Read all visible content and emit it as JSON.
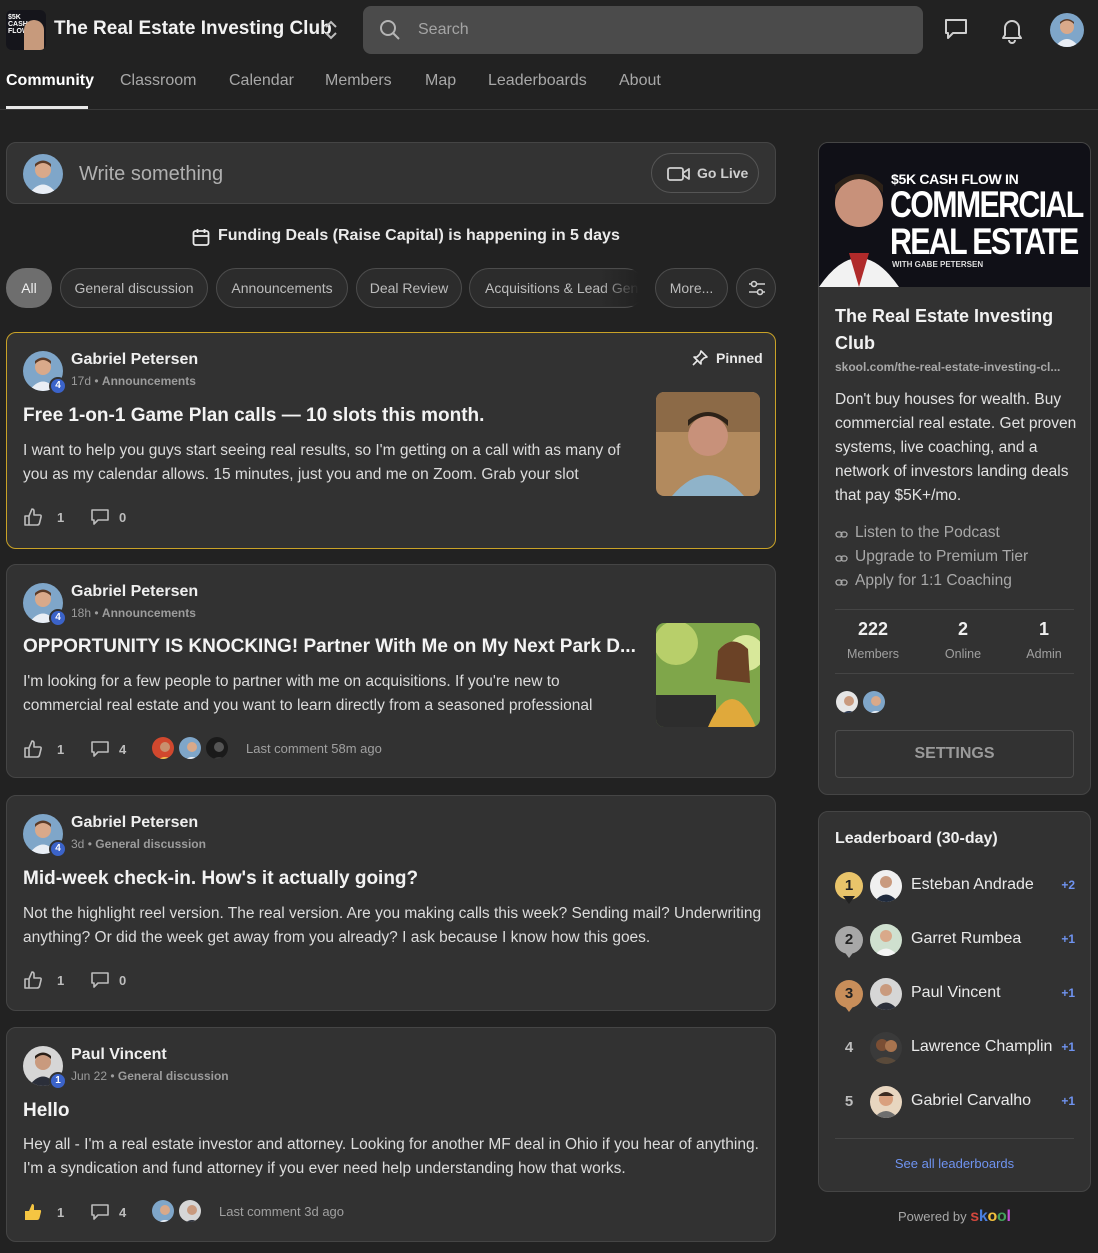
{
  "header": {
    "club_title": "The Real Estate Investing Club",
    "logo_text": "$5K CASH FLOW",
    "search_placeholder": "Search",
    "icons": [
      "chevron-updown-icon",
      "search-icon",
      "chat-icon",
      "bell-icon"
    ]
  },
  "nav": {
    "tabs": [
      {
        "label": "Community",
        "active": true
      },
      {
        "label": "Classroom"
      },
      {
        "label": "Calendar"
      },
      {
        "label": "Members"
      },
      {
        "label": "Map"
      },
      {
        "label": "Leaderboards"
      },
      {
        "label": "About"
      }
    ]
  },
  "composer": {
    "placeholder": "Write something",
    "go_live": "Go Live"
  },
  "event_banner": {
    "text": "Funding Deals (Raise Capital) is happening in 5 days"
  },
  "filters": {
    "chips": [
      "All",
      "General discussion",
      "Announcements",
      "Deal Review",
      "Acquisitions & Lead Gen",
      "More..."
    ]
  },
  "posts": [
    {
      "author": "Gabriel Petersen",
      "level": "4",
      "time": "17d",
      "category": "Announcements",
      "pinned_label": "Pinned",
      "title": "Free 1-on-1 Game Plan calls — 10 slots this month.",
      "body": "I want to help you guys start seeing real results, so I'm getting on a call with as many of you as my calendar allows. 15 minutes, just you and me on Zoom. Grab your slot",
      "likes": "1",
      "comments": "0"
    },
    {
      "author": "Gabriel Petersen",
      "level": "4",
      "time": "18h",
      "category": "Announcements",
      "title": "OPPORTUNITY IS KNOCKING! Partner With Me on My Next Park D...",
      "body": "I'm looking for a few people to partner with me on acquisitions. If you're new to commercial real estate and you want to learn directly from a seasoned professional",
      "likes": "1",
      "comments": "4",
      "last_comment": "Last comment 58m ago"
    },
    {
      "author": "Gabriel Petersen",
      "level": "4",
      "time": "3d",
      "category": "General discussion",
      "title": "Mid-week check-in. How's it actually going?",
      "body": "Not the highlight reel version. The real version. Are you making calls this week? Sending mail? Underwriting anything? Or did the week get away from you already? I ask because I know how this goes.",
      "likes": "1",
      "comments": "0"
    },
    {
      "author": "Paul Vincent",
      "level": "1",
      "time": "Jun 22",
      "category": "General discussion",
      "title": "Hello",
      "body": "Hey all - I'm a real estate investor and attorney. Looking for another MF deal in Ohio if you hear of anything. I'm a syndication and fund attorney if you ever need help understanding how that works.",
      "likes": "1",
      "comments": "4",
      "last_comment": "Last comment 3d ago"
    }
  ],
  "about_card": {
    "banner": {
      "line1": "$5K CASH FLOW IN",
      "line2": "COMMERCIAL",
      "line3": "REAL ESTATE",
      "line4": "WITH GABE PETERSEN"
    },
    "title": "The Real Estate Investing Club",
    "url": "skool.com/the-real-estate-investing-cl...",
    "description": "Don't buy houses for wealth. Buy commercial real estate. Get proven systems, live coaching, and a network of investors landing deals that pay $5K+/mo.",
    "links": [
      "Listen to the Podcast",
      "Upgrade to Premium Tier",
      "Apply for 1:1 Coaching"
    ],
    "stats": [
      {
        "value": "222",
        "label": "Members"
      },
      {
        "value": "2",
        "label": "Online"
      },
      {
        "value": "1",
        "label": "Admin"
      }
    ],
    "settings_label": "SETTINGS"
  },
  "leaderboard": {
    "title": "Leaderboard (30-day)",
    "rows": [
      {
        "rank": "1",
        "name": "Esteban Andrade",
        "points": "+2"
      },
      {
        "rank": "2",
        "name": "Garret Rumbea",
        "points": "+1"
      },
      {
        "rank": "3",
        "name": "Paul Vincent",
        "points": "+1"
      },
      {
        "rank": "4",
        "name": "Lawrence Champlin",
        "points": "+1"
      },
      {
        "rank": "5",
        "name": "Gabriel Carvalho",
        "points": "+1"
      }
    ],
    "see_all": "See all leaderboards"
  },
  "footer": {
    "powered_by": "Powered by",
    "brand": "skool"
  },
  "colors": {
    "background": "#222222",
    "card": "#323232",
    "pinned_border": "#c9a227",
    "level_badge": "#3b63c9",
    "link_blue": "#6f93f0",
    "gold": "#e9c46a",
    "silver": "#a7a7a7",
    "bronze": "#c88e5a"
  }
}
